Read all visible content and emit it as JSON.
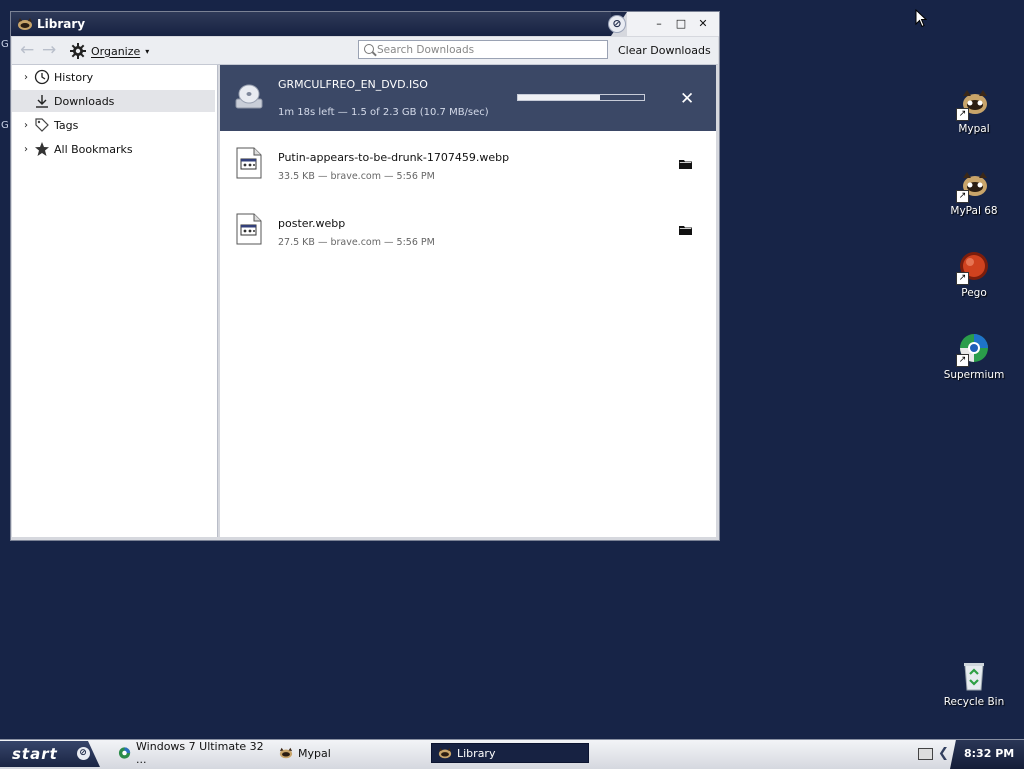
{
  "window": {
    "title": "Library",
    "controls": {
      "minimize": "–",
      "maximize": "□",
      "close": "✕"
    }
  },
  "toolbar": {
    "back_icon": "←",
    "forward_icon": "→",
    "organize_label": "Organize",
    "organize_caret": "▾",
    "search_placeholder": "Search Downloads",
    "search_value": "",
    "clear_downloads_label": "Clear Downloads"
  },
  "sidebar": {
    "items": [
      {
        "label": "History",
        "icon": "clock-icon",
        "expandable": true,
        "selected": false
      },
      {
        "label": "Downloads",
        "icon": "download-icon",
        "expandable": false,
        "selected": true
      },
      {
        "label": "Tags",
        "icon": "tag-icon",
        "expandable": true,
        "selected": false
      },
      {
        "label": "All Bookmarks",
        "icon": "star-icon",
        "expandable": true,
        "selected": false
      }
    ]
  },
  "downloads": {
    "active": {
      "name": "GRMCULFREO_EN_DVD.ISO",
      "status": "1m 18s left — 1.5 of 2.3 GB (10.7 MB/sec)",
      "progress": 0.65,
      "icon": "disc-drive-icon"
    },
    "completed": [
      {
        "name": "Putin-appears-to-be-drunk-1707459.webp",
        "meta": "33.5 KB — brave.com — 5:56 PM",
        "icon": "image-file-icon"
      },
      {
        "name": "poster.webp",
        "meta": "27.5 KB — brave.com — 5:56 PM",
        "icon": "image-file-icon"
      }
    ]
  },
  "desktop": {
    "icons": [
      {
        "label": "Mypal",
        "icon": "mypal-icon"
      },
      {
        "label": "MyPal 68",
        "icon": "mypal-icon"
      },
      {
        "label": "Pego",
        "icon": "pego-icon"
      },
      {
        "label": "Supermium",
        "icon": "supermium-icon"
      },
      {
        "label": "Recycle Bin",
        "icon": "recycle-bin-icon"
      }
    ]
  },
  "taskbar": {
    "start_label": "start",
    "tasks": [
      {
        "label": "Windows 7 Ultimate 32 ...",
        "icon": "globe-icon",
        "active": false
      },
      {
        "label": "Mypal",
        "icon": "mypal-icon",
        "active": false
      },
      {
        "label": "Library",
        "icon": "mypal-icon",
        "active": true
      }
    ],
    "clock": "8:32 PM"
  },
  "colors": {
    "desktop": "#172447",
    "titlebar": "#1d2849",
    "active_download_bg": "#3b4866",
    "selected_sidebar": "#e3e4e8"
  }
}
